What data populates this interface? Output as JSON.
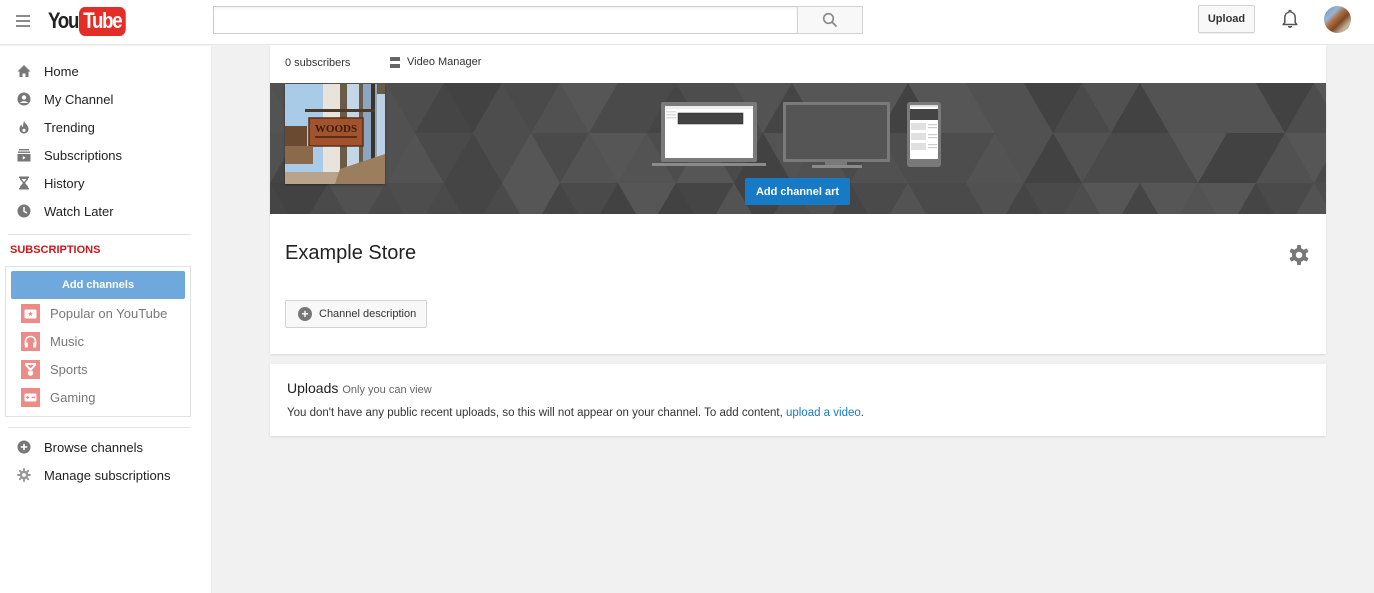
{
  "header": {
    "logo_you": "You",
    "logo_tube": "Tube",
    "search_value": "",
    "search_placeholder": "",
    "upload_label": "Upload"
  },
  "sidebar": {
    "nav": [
      {
        "label": "Home",
        "icon": "home-icon"
      },
      {
        "label": "My Channel",
        "icon": "person-icon"
      },
      {
        "label": "Trending",
        "icon": "flame-icon"
      },
      {
        "label": "Subscriptions",
        "icon": "subscriptions-icon"
      },
      {
        "label": "History",
        "icon": "hourglass-icon"
      },
      {
        "label": "Watch Later",
        "icon": "clock-icon"
      }
    ],
    "subscriptions_title": "SUBSCRIPTIONS",
    "add_channels_label": "Add channels",
    "suggested": [
      {
        "label": "Popular on YouTube",
        "icon": "popular-icon"
      },
      {
        "label": "Music",
        "icon": "headphones-icon"
      },
      {
        "label": "Sports",
        "icon": "trophy-icon"
      },
      {
        "label": "Gaming",
        "icon": "gamepad-icon"
      }
    ],
    "footer": [
      {
        "label": "Browse channels",
        "icon": "plus-circle-icon"
      },
      {
        "label": "Manage subscriptions",
        "icon": "gear-icon"
      }
    ]
  },
  "channel": {
    "subscribers": "0 subscribers",
    "video_manager_label": "Video Manager",
    "add_channel_art_label": "Add channel art",
    "name": "Example Store",
    "description_button_label": "Channel description",
    "profile_sign_text": "WOODS"
  },
  "uploads": {
    "title": "Uploads",
    "visibility": "Only you can view",
    "message": "You don't have any public recent uploads, so this will not appear on your channel. To add content, ",
    "link_label": "upload a video",
    "message_end": "."
  },
  "colors": {
    "brand_red": "#e52d27",
    "subscriptions_red": "#cc181e",
    "primary_blue": "#167ac6",
    "add_channels_blue": "#6fa8dc",
    "suggested_icon_bg": "#ec8b87"
  }
}
